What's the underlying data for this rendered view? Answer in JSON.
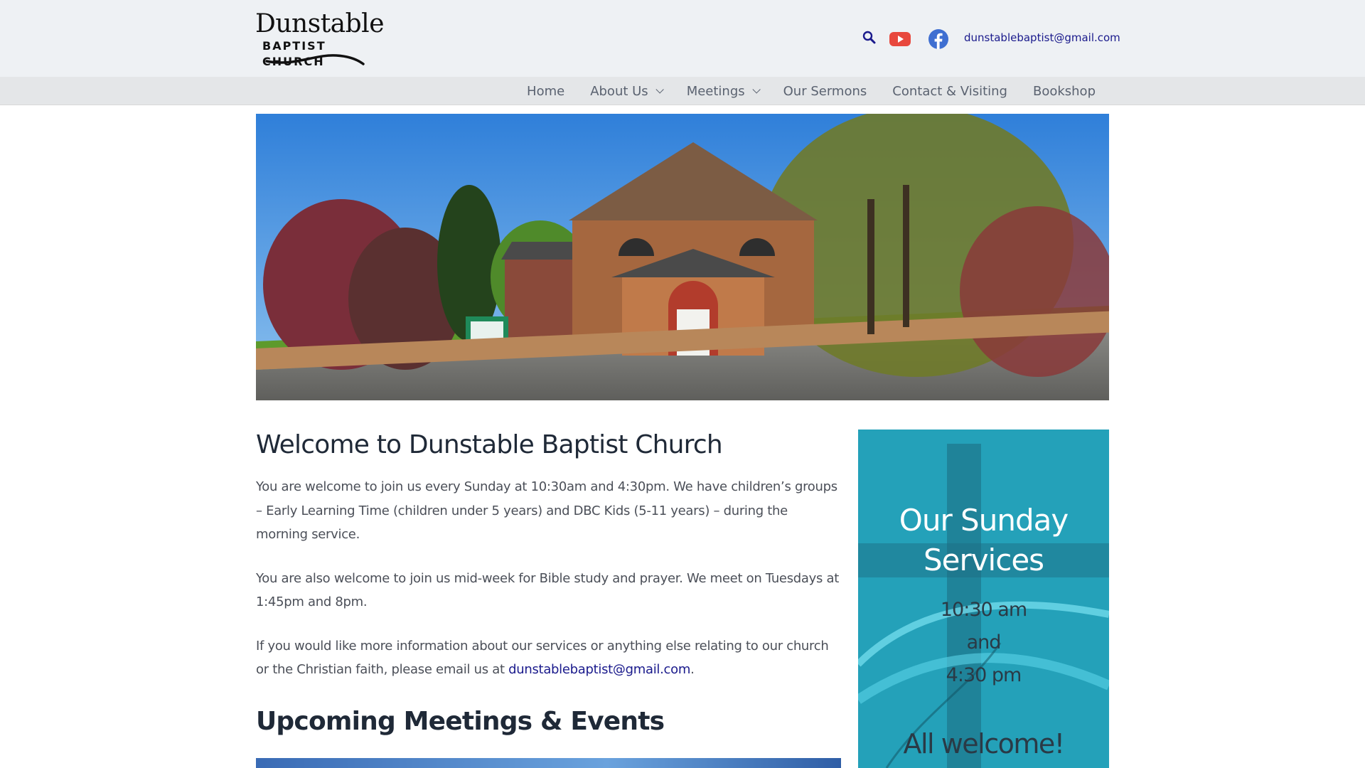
{
  "header": {
    "logo_title": "Dunstable",
    "logo_subtitle": "BAPTIST CHURCH",
    "email": "dunstablebaptist@gmail.com",
    "icons": [
      "search-icon",
      "youtube-icon",
      "facebook-icon"
    ]
  },
  "nav": {
    "items": [
      {
        "label": "Home",
        "dropdown": false
      },
      {
        "label": "About Us",
        "dropdown": true
      },
      {
        "label": "Meetings",
        "dropdown": true
      },
      {
        "label": "Our Sermons",
        "dropdown": false
      },
      {
        "label": "Contact & Visiting",
        "dropdown": false
      },
      {
        "label": "Bookshop",
        "dropdown": false
      }
    ]
  },
  "main": {
    "heading": "Welcome to Dunstable Baptist Church",
    "para1": "You are welcome to join us every Sunday at 10:30am and 4:30pm. We have children’s groups – Early Learning Time (children under 5 years) and DBC Kids (5-11 years) – during the morning service.",
    "para2": "You are also welcome to join us mid-week for Bible study and prayer. We meet on Tuesdays at 1:45pm and 8pm.",
    "para3_prefix": "If you would like more information about our services or anything else relating to our church or the Christian faith, please email us at ",
    "para3_link": "dunstablebaptist@gmail.com",
    "para3_suffix": ".",
    "heading2": "Upcoming Meetings & Events"
  },
  "sidebar": {
    "title_line1": "Our Sunday",
    "title_line2": "Services",
    "time1": "10:30 am",
    "and": "and",
    "time2": "4:30 pm",
    "welcome": "All welcome!"
  },
  "colors": {
    "topbar_bg": "#eef1f4",
    "nav_bg": "#e4e6e8",
    "link": "#1a1a8c",
    "heading": "#1f2937",
    "card_bg": "#2bb7cf"
  }
}
